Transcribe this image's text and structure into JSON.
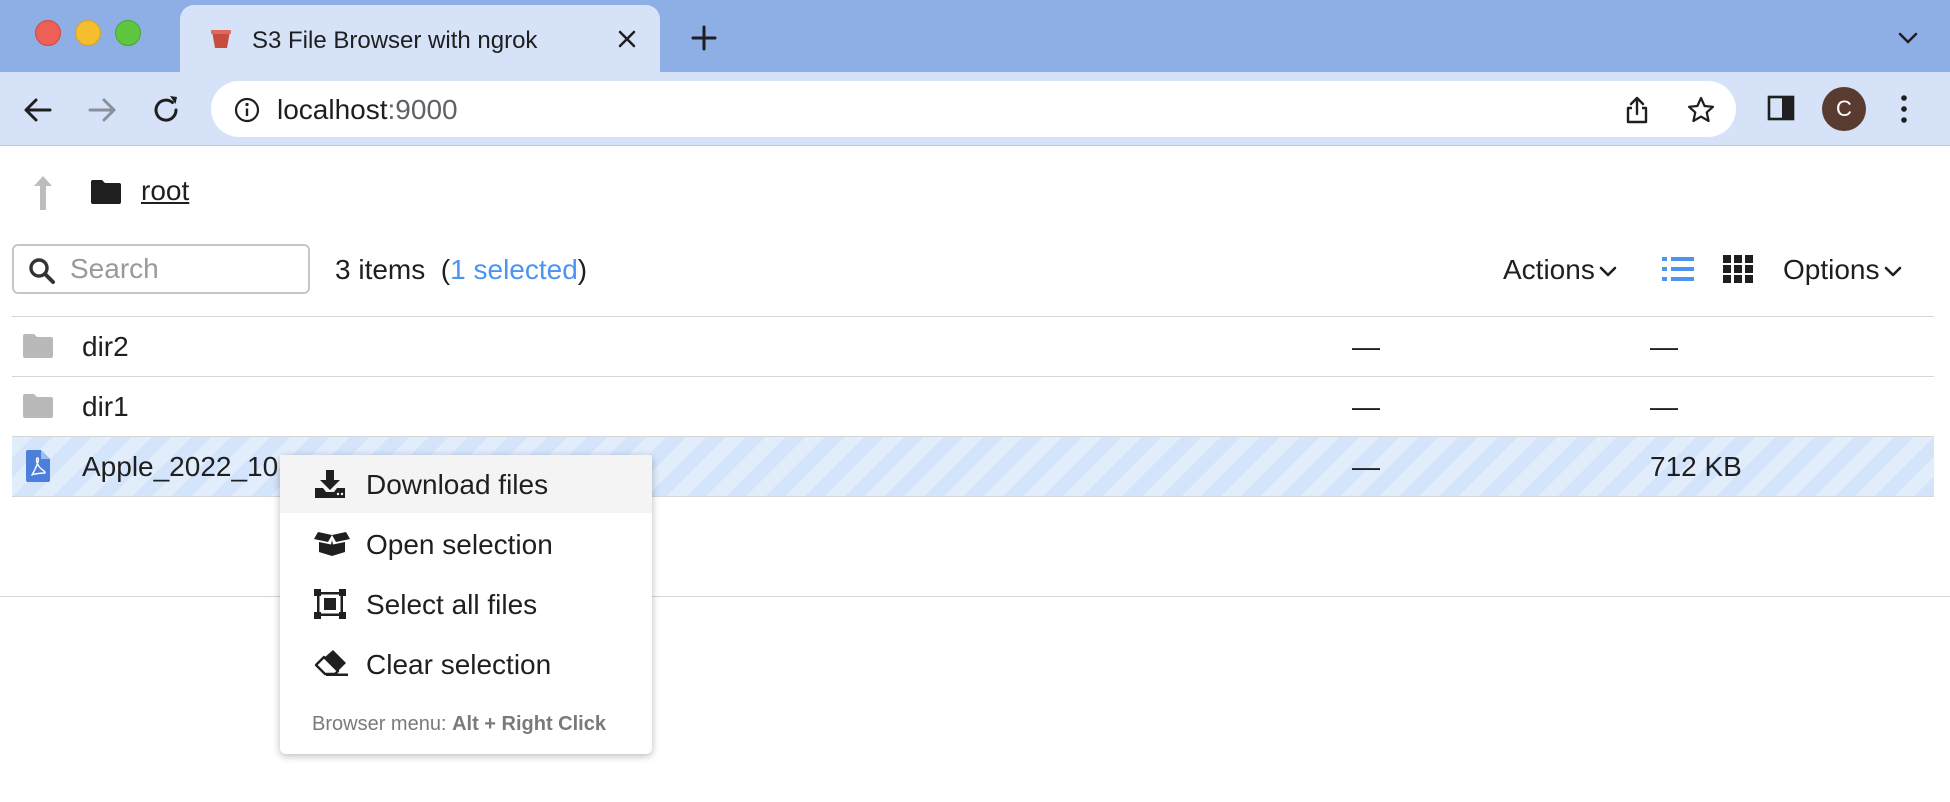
{
  "browser": {
    "tab_title": "S3 File Browser with ngrok",
    "url_host": "localhost",
    "url_port": ":9000",
    "profile_initial": "C"
  },
  "page": {
    "breadcrumb_root": "root",
    "search_placeholder": "Search",
    "item_count_label": "3 items",
    "selected_label": "1 selected",
    "actions_label": "Actions",
    "options_label": "Options",
    "view_mode": "list"
  },
  "files": [
    {
      "name": "dir2",
      "type": "folder",
      "modified": "—",
      "size": "—",
      "selected": false
    },
    {
      "name": "dir1",
      "type": "folder",
      "modified": "—",
      "size": "—",
      "selected": false
    },
    {
      "name": "Apple_2022_10",
      "type": "pdf",
      "modified": "—",
      "size": "712 KB",
      "selected": true
    }
  ],
  "context_menu": {
    "items": [
      {
        "label": "Download files",
        "icon": "download-icon"
      },
      {
        "label": "Open selection",
        "icon": "open-box-icon"
      },
      {
        "label": "Select all files",
        "icon": "select-all-icon"
      },
      {
        "label": "Clear selection",
        "icon": "eraser-icon"
      }
    ],
    "hint_prefix": "Browser menu: ",
    "hint_keys": "Alt + Right Click"
  },
  "colors": {
    "tabstrip": "#8eaee6",
    "toolbar": "#d5e2f8",
    "accent_blue": "#4b95f0",
    "selected_row": "#d3e4fb"
  }
}
